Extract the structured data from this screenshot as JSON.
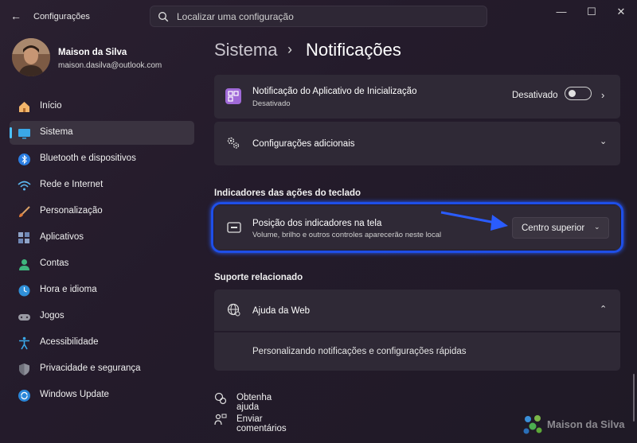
{
  "window": {
    "app_title": "Configurações",
    "controls": [
      "—",
      "☐",
      "✕"
    ]
  },
  "search": {
    "placeholder": "Localizar uma configuração"
  },
  "user": {
    "name": "Maison da Silva",
    "email": "maison.dasilva@outlook.com"
  },
  "sidebar": {
    "items": [
      {
        "label": "Início",
        "icon": "home-icon"
      },
      {
        "label": "Sistema",
        "icon": "system-icon",
        "active": true
      },
      {
        "label": "Bluetooth e dispositivos",
        "icon": "bluetooth-icon"
      },
      {
        "label": "Rede e Internet",
        "icon": "wifi-icon"
      },
      {
        "label": "Personalização",
        "icon": "brush-icon"
      },
      {
        "label": "Aplicativos",
        "icon": "apps-icon"
      },
      {
        "label": "Contas",
        "icon": "account-icon"
      },
      {
        "label": "Hora e idioma",
        "icon": "globe-clock-icon"
      },
      {
        "label": "Jogos",
        "icon": "gamepad-icon"
      },
      {
        "label": "Acessibilidade",
        "icon": "accessibility-icon"
      },
      {
        "label": "Privacidade e segurança",
        "icon": "shield-icon"
      },
      {
        "label": "Windows Update",
        "icon": "update-icon"
      }
    ]
  },
  "breadcrumb": {
    "parent": "Sistema",
    "separator": "›",
    "current": "Notificações"
  },
  "startup_card": {
    "title": "Notificação do Aplicativo de Inicialização",
    "subtitle": "Desativado",
    "toggle_label": "Desativado",
    "toggle_on": false
  },
  "additional_card": {
    "title": "Configurações adicionais"
  },
  "keyboard_section": {
    "heading": "Indicadores das ações do teclado",
    "title": "Posição dos indicadores na tela",
    "subtitle": "Volume, brilho e outros controles aparecerão neste local",
    "dropdown_value": "Centro superior"
  },
  "support_section": {
    "heading": "Suporte relacionado",
    "help_title": "Ajuda da Web",
    "link": "Personalizando notificações e configurações rápidas"
  },
  "footer_links": {
    "help": "Obtenha ajuda",
    "feedback": "Enviar comentários"
  },
  "watermark": {
    "text": "Maison da Silva"
  },
  "colors": {
    "accent": "#4cc2ff",
    "highlight": "#1e4fe8",
    "card": "#2f2936"
  }
}
